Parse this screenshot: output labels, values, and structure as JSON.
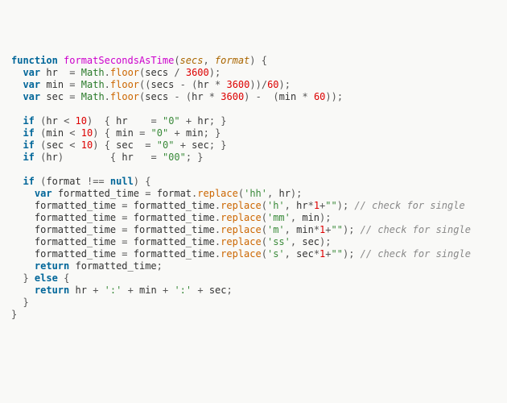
{
  "code": {
    "l01": {
      "kw_fn": "function",
      "fname": "formatSecondsAsTime",
      "p1": "secs",
      "p2": "format"
    },
    "l02": {
      "kw_var": "var",
      "name": "hr",
      "obj": "Math",
      "met": "floor",
      "arg_a": "secs",
      "num": "3600"
    },
    "l03": {
      "kw_var": "var",
      "name": "min",
      "obj": "Math",
      "met": "floor",
      "a": "secs",
      "b": "hr",
      "n1": "3600",
      "n2": "60"
    },
    "l04": {
      "kw_var": "var",
      "name": "sec",
      "obj": "Math",
      "met": "floor",
      "a": "secs",
      "b": "hr",
      "n1": "3600",
      "c": "min",
      "n2": "60"
    },
    "l06": {
      "kw_if": "if",
      "v": "hr",
      "n": "10",
      "assign": "hr",
      "str": "\"0\"",
      "plus": "hr"
    },
    "l07": {
      "kw_if": "if",
      "v": "min",
      "n": "10",
      "assign": "min",
      "str": "\"0\"",
      "plus": "min"
    },
    "l08": {
      "kw_if": "if",
      "v": "sec",
      "n": "10",
      "assign": "sec",
      "str": "\"0\"",
      "plus": "sec"
    },
    "l09": {
      "kw_if": "if",
      "v": "hr",
      "assign": "hr",
      "str": "\"00\""
    },
    "l11": {
      "kw_if": "if",
      "v": "format",
      "kw_null": "null"
    },
    "l12": {
      "kw_var": "var",
      "name": "formatted_time",
      "src": "format",
      "met": "replace",
      "s": "'hh'",
      "arg": "hr"
    },
    "l13": {
      "name": "formatted_time",
      "src": "formatted_time",
      "met": "replace",
      "s": "'h'",
      "arg": "hr",
      "one": "1",
      "emp": "\"\"",
      "cmt": "// check for single"
    },
    "l14": {
      "name": "formatted_time",
      "src": "formatted_time",
      "met": "replace",
      "s": "'mm'",
      "arg": "min"
    },
    "l15": {
      "name": "formatted_time",
      "src": "formatted_time",
      "met": "replace",
      "s": "'m'",
      "arg": "min",
      "one": "1",
      "emp": "\"\"",
      "cmt": "// check for single"
    },
    "l16": {
      "name": "formatted_time",
      "src": "formatted_time",
      "met": "replace",
      "s": "'ss'",
      "arg": "sec"
    },
    "l17": {
      "name": "formatted_time",
      "src": "formatted_time",
      "met": "replace",
      "s": "'s'",
      "arg": "sec",
      "one": "1",
      "emp": "\"\"",
      "cmt": "// check for single"
    },
    "l18": {
      "kw_ret": "return",
      "v": "formatted_time"
    },
    "l19": {
      "kw_else": "else"
    },
    "l20": {
      "kw_ret": "return",
      "a": "hr",
      "s": "':'",
      "b": "min",
      "c": "sec"
    }
  }
}
